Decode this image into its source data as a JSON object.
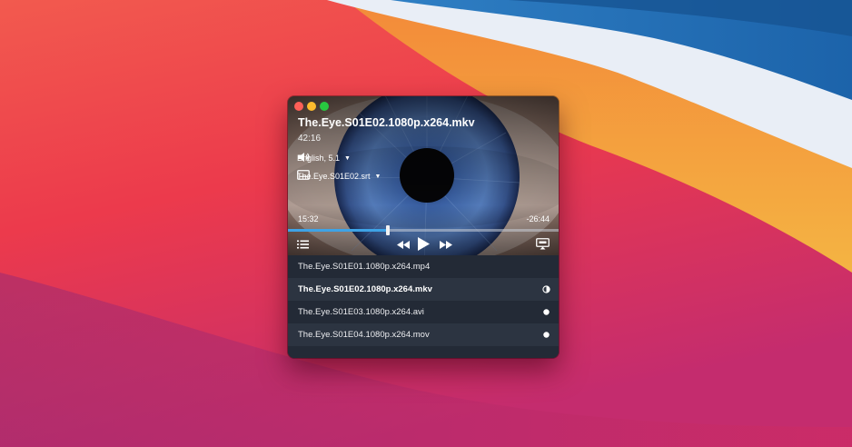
{
  "player": {
    "title": "The.Eye.S01E02.1080p.x264.mkv",
    "duration": "42:16",
    "audio_track": "English, 5.1",
    "subtitle_track": "The.Eye.S01E02.srt",
    "elapsed": "15:32",
    "remaining": "-26:44",
    "progress": 0.37
  },
  "playlist": [
    {
      "name": "The.Eye.S01E01.1080p.x264.mp4",
      "status": "none",
      "active": false
    },
    {
      "name": "The.Eye.S01E02.1080p.x264.mkv",
      "status": "half",
      "active": true
    },
    {
      "name": "The.Eye.S01E03.1080p.x264.avi",
      "status": "full",
      "active": false
    },
    {
      "name": "The.Eye.S01E04.1080p.x264.mov",
      "status": "full",
      "active": false
    }
  ],
  "colors": {
    "accent": "#3ea3e6",
    "playlist_bg": "#232a36",
    "playlist_row_alt": "#2c3441"
  },
  "icons": {
    "volume": "speaker-icon",
    "subtitles": "subtitles-icon",
    "playlist": "list-icon",
    "rewind": "rewind-icon",
    "play": "play-icon",
    "forward": "fast-forward-icon",
    "airplay": "airplay-icon"
  }
}
